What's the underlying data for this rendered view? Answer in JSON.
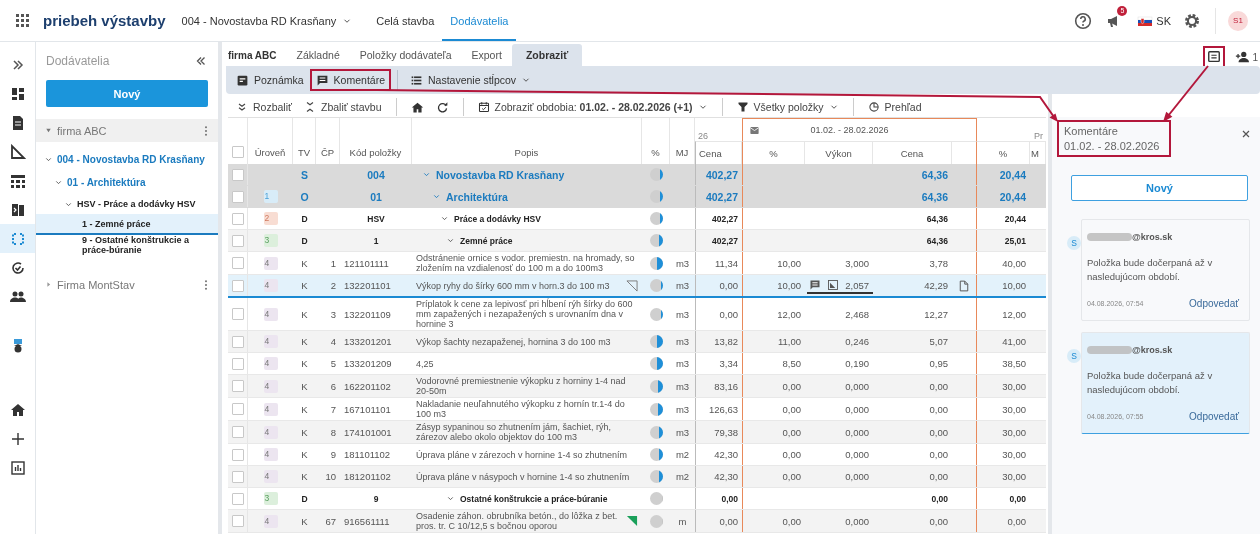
{
  "topbar": {
    "title": "priebeh výstavby",
    "project": "004 - Novostavba RD Krasňany",
    "nav": [
      {
        "label": "Celá stavba",
        "selected": false
      },
      {
        "label": "Dodávatelia",
        "selected": true
      }
    ],
    "notification_count": "5",
    "language": "SK",
    "user_initials": "S1"
  },
  "rail": [
    {
      "selected": false
    },
    {
      "selected": false
    },
    {
      "selected": false
    },
    {
      "selected": false
    },
    {
      "selected": false
    },
    {
      "selected": false
    },
    {
      "selected": true
    },
    {
      "selected": false
    },
    {
      "selected": false
    },
    {
      "selected": false
    },
    {
      "selected": false
    },
    {
      "selected": false
    },
    {
      "selected": false
    }
  ],
  "sidebar": {
    "title": "Dodávatelia",
    "new_button": "Nový",
    "tree": [
      {
        "label": "firma ABC",
        "kind": "company",
        "expanded": true,
        "selected": false,
        "children": [
          {
            "label": "004 - Novostavba RD Krasňany",
            "kind": "project",
            "expanded": true,
            "selected": false,
            "children": [
              {
                "label": "01 - Architektúra",
                "kind": "object",
                "expanded": true,
                "selected": false,
                "children": [
                  {
                    "label": "HSV - Práce a dodávky HSV",
                    "kind": "group",
                    "expanded": true,
                    "selected": false,
                    "children": [
                      {
                        "label": "1 - Zemné práce",
                        "kind": "leaf",
                        "selected": true
                      },
                      {
                        "label": "9 - Ostatné konštrukcie a práce-búranie",
                        "kind": "leaf",
                        "selected": false
                      }
                    ]
                  }
                ]
              }
            ]
          }
        ]
      },
      {
        "label": "Firma MontStav",
        "kind": "company",
        "expanded": false,
        "selected": false
      }
    ]
  },
  "main": {
    "subject": "firma ABC",
    "tabs": [
      {
        "label": "Základné",
        "selected": false
      },
      {
        "label": "Položky dodávateľa",
        "selected": false
      },
      {
        "label": "Export",
        "selected": false
      },
      {
        "label": "Zobraziť",
        "selected": true
      }
    ],
    "ribbon": [
      {
        "label": "Poznámka",
        "kind": "note",
        "highlighted": false
      },
      {
        "label": "Komentáre",
        "kind": "comments",
        "highlighted": true
      },
      {
        "label": "Nastavenie stĺpcov",
        "kind": "columns",
        "highlighted": false
      }
    ],
    "panel_toggle": {
      "highlighted": true
    },
    "share_count": "1",
    "toolbar": {
      "expand": "Rozbaliť",
      "collapse": "Zbaliť stavbu",
      "period_label": "Zobraziť obdobia:",
      "period_value": "01.02. - 28.02.2026 (+1)",
      "filter": "Všetky položky",
      "overview": "Prehľad"
    }
  },
  "table": {
    "group_headers": {
      "previous": "26",
      "period": "01.02. - 28.02.2026",
      "next": "Pr"
    },
    "header_checked": false,
    "columns": [
      "Úroveň",
      "TV",
      "ČP",
      "Kód položky",
      "Popis",
      "%",
      "MJ",
      "Cena",
      "%",
      "Výkon",
      "Cena",
      "%",
      "M"
    ],
    "rows": [
      {
        "kind": "building",
        "checked": false,
        "selected": false,
        "tv": "S",
        "code": "004",
        "description": "Novostavba RD Krasňany",
        "expanded": true,
        "level": 0.22,
        "prev_cena": "402,27",
        "period_cena": "64,36",
        "next_pct": "20,44"
      },
      {
        "kind": "object",
        "checked": false,
        "selected": false,
        "badge": {
          "text": "1",
          "color": "#d8ecf8"
        },
        "tv": "O",
        "code": "01",
        "description": "Architektúra",
        "expanded": true,
        "level": 0.22,
        "prev_cena": "402,27",
        "period_cena": "64,36",
        "next_pct": "20,44"
      },
      {
        "kind": "division",
        "checked": false,
        "selected": false,
        "badge": {
          "text": "2",
          "color": "#f8ddd3"
        },
        "tv": "D",
        "code": "HSV",
        "description": "Práce a dodávky HSV",
        "expanded": true,
        "level": 0.22,
        "prev_cena": "402,27",
        "period_cena": "64,36",
        "next_pct": "20,44"
      },
      {
        "kind": "section",
        "checked": false,
        "selected": false,
        "badge": {
          "text": "3",
          "color": "#dcefdc"
        },
        "tv": "D",
        "code": "1",
        "description": "Zemné práce",
        "expanded": true,
        "level": 0.25,
        "prev_cena": "402,27",
        "period_cena": "64,36",
        "next_pct": "25,01"
      },
      {
        "kind": "item",
        "checked": false,
        "selected": false,
        "badge": {
          "text": "4",
          "color": "#ece5f0"
        },
        "tv": "K",
        "cp": "1",
        "code": "121101111",
        "description": "Odstránenie ornice s vodor. premiestn. na hromady, so zložením na vzdialenosť do 100 m a do 100m3",
        "level": 0.45,
        "mj": "m3",
        "prev_cena": "11,34",
        "period_pct": "10,00",
        "vykon": "3,000",
        "period_cena": "3,78",
        "next_pct": "40,00"
      },
      {
        "kind": "item",
        "checked": false,
        "selected": true,
        "note": true,
        "has_comments": true,
        "badge": {
          "text": "4",
          "color": "#ece5f0"
        },
        "tv": "K",
        "cp": "2",
        "code": "132201101",
        "description": "Výkop ryhy do šírky 600 mm v horn.3 do 100 m3",
        "level": 0.1,
        "mj": "m3",
        "prev_cena": "0,00",
        "period_pct": "10,00",
        "vykon": "2,057",
        "period_cena": "42,29",
        "next_pct": "10,00"
      },
      {
        "kind": "item",
        "checked": false,
        "selected": false,
        "badge": {
          "text": "4",
          "color": "#ece5f0"
        },
        "tv": "K",
        "cp": "3",
        "code": "132201109",
        "description": "Príplatok k cene za lepivosť pri hĺbení rýh šírky do 600 mm zapažených i nezapažených s urovnaním dna v hornine 3",
        "level": 0.1,
        "mj": "m3",
        "prev_cena": "0,00",
        "period_pct": "12,00",
        "vykon": "2,468",
        "period_cena": "12,27",
        "next_pct": "12,00"
      },
      {
        "kind": "item",
        "checked": false,
        "selected": false,
        "badge": {
          "text": "4",
          "color": "#ece5f0"
        },
        "tv": "K",
        "cp": "4",
        "code": "133201201",
        "description": "Výkop šachty nezapaženej, hornina 3 do 100 m3",
        "level": 0.45,
        "mj": "m3",
        "prev_cena": "13,82",
        "period_pct": "11,00",
        "vykon": "0,246",
        "period_cena": "5,07",
        "next_pct": "41,00"
      },
      {
        "kind": "item",
        "checked": false,
        "selected": false,
        "badge": {
          "text": "4",
          "color": "#ece5f0"
        },
        "tv": "K",
        "cp": "5",
        "code": "133201209",
        "description": "4,25",
        "level": 0.42,
        "mj": "m3",
        "prev_cena": "3,34",
        "period_pct": "8,50",
        "vykon": "0,190",
        "period_cena": "0,95",
        "next_pct": "38,50"
      },
      {
        "kind": "item",
        "checked": false,
        "selected": false,
        "badge": {
          "text": "4",
          "color": "#ece5f0"
        },
        "tv": "K",
        "cp": "6",
        "code": "162201102",
        "description": "Vodorovné premiestnenie výkopku z horniny 1-4 nad 20-50m",
        "level": 0.35,
        "mj": "m3",
        "prev_cena": "83,16",
        "period_pct": "0,00",
        "vykon": "0,000",
        "period_cena": "0,00",
        "next_pct": "30,00"
      },
      {
        "kind": "item",
        "checked": false,
        "selected": false,
        "badge": {
          "text": "4",
          "color": "#ece5f0"
        },
        "tv": "K",
        "cp": "7",
        "code": "167101101",
        "description": "Nakladanie neuľahnutého výkopku z hornín tr.1-4 do 100 m3",
        "level": 0.35,
        "mj": "m3",
        "prev_cena": "126,63",
        "period_pct": "0,00",
        "vykon": "0,000",
        "period_cena": "0,00",
        "next_pct": "30,00"
      },
      {
        "kind": "item",
        "checked": false,
        "selected": false,
        "badge": {
          "text": "4",
          "color": "#ece5f0"
        },
        "tv": "K",
        "cp": "8",
        "code": "174101001",
        "description": "Zásyp sypaninou so zhutnením jám, šachiet, rýh, zárezov alebo okolo objektov do 100 m3",
        "level": 0.3,
        "mj": "m3",
        "prev_cena": "79,38",
        "period_pct": "0,00",
        "vykon": "0,000",
        "period_cena": "0,00",
        "next_pct": "30,00"
      },
      {
        "kind": "item",
        "checked": false,
        "selected": false,
        "badge": {
          "text": "4",
          "color": "#ece5f0"
        },
        "tv": "K",
        "cp": "9",
        "code": "181101102",
        "description": "Úprava pláne v zárezoch v hornine 1-4 so zhutnením",
        "level": 0.3,
        "mj": "m2",
        "prev_cena": "42,30",
        "period_pct": "0,00",
        "vykon": "0,000",
        "period_cena": "0,00",
        "next_pct": "30,00"
      },
      {
        "kind": "item",
        "checked": false,
        "selected": false,
        "badge": {
          "text": "4",
          "color": "#ece5f0"
        },
        "tv": "K",
        "cp": "10",
        "code": "181201102",
        "description": "Úprava pláne v násypoch v hornine 1-4 so zhutnením",
        "level": 0.3,
        "mj": "m2",
        "prev_cena": "42,30",
        "period_pct": "0,00",
        "vykon": "0,000",
        "period_cena": "0,00",
        "next_pct": "30,00"
      },
      {
        "kind": "section",
        "checked": false,
        "selected": false,
        "badge": {
          "text": "3",
          "color": "#dcefdc"
        },
        "tv": "D",
        "code": "9",
        "description": "Ostatné konštrukcie a práce-búranie",
        "expanded": true,
        "level": 0,
        "prev_cena": "0,00",
        "period_cena": "0,00",
        "next_pct": "0,00"
      },
      {
        "kind": "item",
        "checked": false,
        "selected": false,
        "flagged": true,
        "badge": {
          "text": "4",
          "color": "#ece5f0"
        },
        "tv": "K",
        "cp": "67",
        "code": "916561111",
        "description": "Osadenie záhon. obrubníka betón., do lôžka z bet. pros. tr. C 10/12,5 s bočnou oporou",
        "level": 0,
        "mj": "m",
        "prev_cena": "0,00",
        "period_pct": "0,00",
        "vykon": "0,000",
        "period_cena": "0,00",
        "next_pct": "0,00"
      }
    ]
  },
  "panel": {
    "title": "Komentáre",
    "period": "01.02. - 28.02.2026",
    "highlighted": true,
    "new_button": "Nový",
    "comments": [
      {
        "avatar": "S",
        "author": "@kros.sk",
        "text": "Položka bude dočerpaná až v nasledujúcom období.",
        "time": "04.08.2026, 07:54",
        "reply": "Odpovedať",
        "selected": false
      },
      {
        "avatar": "S",
        "author": "@kros.sk",
        "text": "Položka bude dočerpaná až v nasledujúcom období.",
        "time": "04.08.2026, 07:55",
        "reply": "Odpovedať",
        "selected": true
      }
    ]
  }
}
